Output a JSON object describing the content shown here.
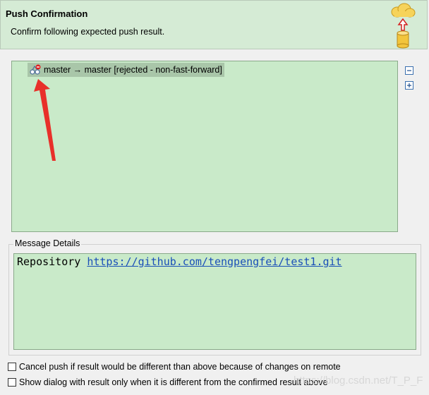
{
  "dialog": {
    "title": "Push Confirmation",
    "subtitle": "Confirm following expected push result."
  },
  "result_tree": {
    "row_text": "master → master [rejected - non-fast-forward]",
    "row_icon": "ref-rejected-icon"
  },
  "side_buttons": {
    "collapse_icon": "collapse-all-icon",
    "expand_icon": "expand-all-icon"
  },
  "message_details": {
    "legend": "Message Details",
    "prefix": "Repository ",
    "url": "https://github.com/tengpengfei/test1.git"
  },
  "options": {
    "cancel_push_label": "Cancel push if result would be different than above because of changes on remote",
    "show_dialog_label": "Show dialog with result only when it is different from the confirmed result above"
  },
  "watermark": "https://blog.csdn.net/T_P_F",
  "colors": {
    "banner_bg": "#d5ebd5",
    "area_bg": "#c9eac9",
    "selection_bg": "#a9c6a9",
    "link": "#1a4fb8",
    "annotation": "#e8302a"
  }
}
